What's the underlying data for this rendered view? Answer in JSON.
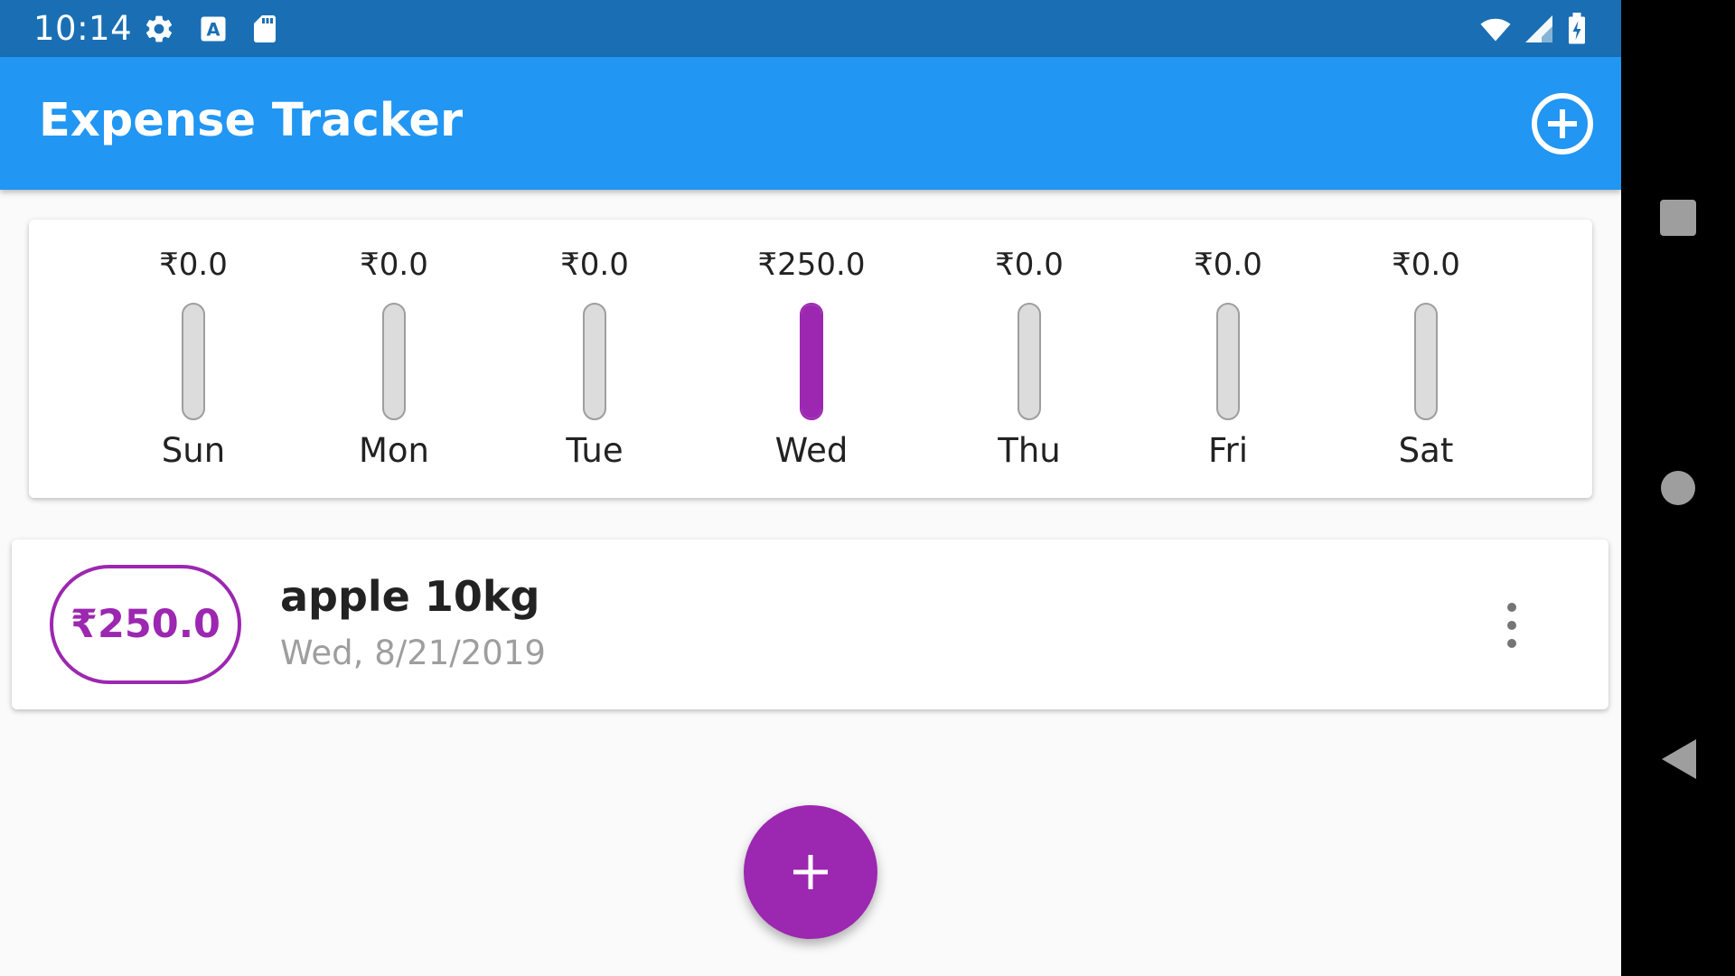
{
  "status_bar": {
    "time": "10:14",
    "left_icons": [
      "settings-icon",
      "a-notification-icon",
      "sd-card-icon"
    ],
    "right_icons": [
      "wifi-icon",
      "signal-icon",
      "battery-charging-icon"
    ]
  },
  "app_bar": {
    "title": "Expense Tracker",
    "action_icon": "add-circle-icon"
  },
  "colors": {
    "status_bar": "#1a6fb4",
    "app_bar": "#2196f3",
    "accent": "#9c27b0",
    "bar_track": "#dcdcdc"
  },
  "weekly_chart": {
    "days": [
      {
        "label": "Sun",
        "amount": "₹0.0",
        "fill": 0
      },
      {
        "label": "Mon",
        "amount": "₹0.0",
        "fill": 0
      },
      {
        "label": "Tue",
        "amount": "₹0.0",
        "fill": 0
      },
      {
        "label": "Wed",
        "amount": "₹250.0",
        "fill": 1
      },
      {
        "label": "Thu",
        "amount": "₹0.0",
        "fill": 0
      },
      {
        "label": "Fri",
        "amount": "₹0.0",
        "fill": 0
      },
      {
        "label": "Sat",
        "amount": "₹0.0",
        "fill": 0
      }
    ]
  },
  "transactions": [
    {
      "amount": "₹250.0",
      "title": "apple 10kg",
      "date": "Wed, 8/21/2019",
      "menu_icon": "more-vert-icon"
    }
  ],
  "fab": {
    "icon": "plus-icon"
  },
  "nav_bar": {
    "icons": [
      "recents-icon",
      "home-icon",
      "back-icon"
    ]
  }
}
